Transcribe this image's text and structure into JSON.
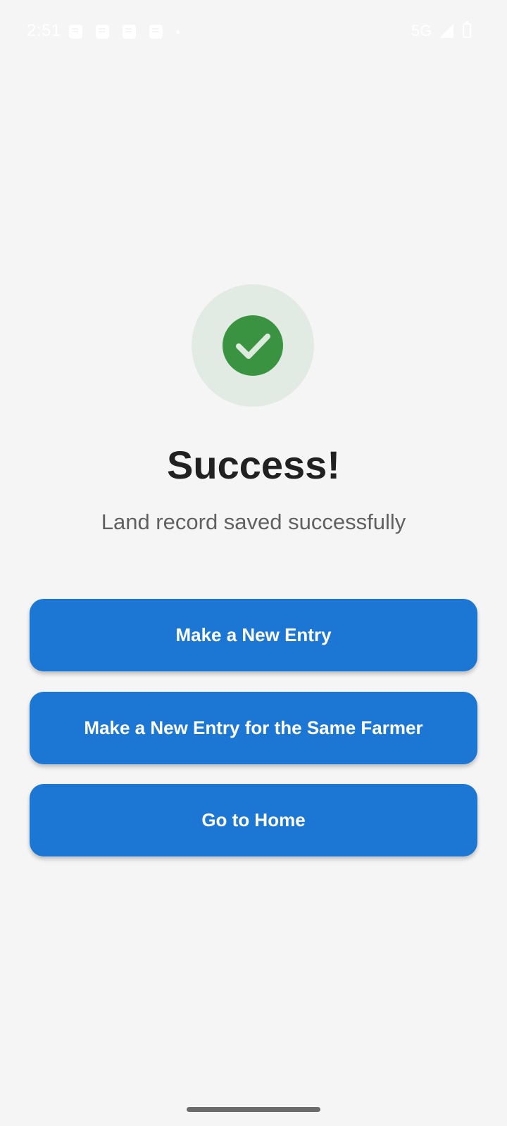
{
  "status_bar": {
    "time": "2:51",
    "network": "5G",
    "notification_icons": [
      "notification-icon",
      "notification-icon",
      "notification-icon",
      "notification-icon"
    ],
    "signal_icon": "signal-icon",
    "battery_icon": "battery-icon"
  },
  "success": {
    "icon": "check-circle-icon",
    "title": "Success!",
    "message": "Land record saved successfully",
    "icon_color": "#3a9340",
    "icon_bg_color": "#e2ebe3"
  },
  "actions": {
    "new_entry_label": "Make a New Entry",
    "new_entry_same_farmer_label": "Make a New Entry for the Same Farmer",
    "go_home_label": "Go to Home",
    "button_color": "#1c77d4"
  }
}
